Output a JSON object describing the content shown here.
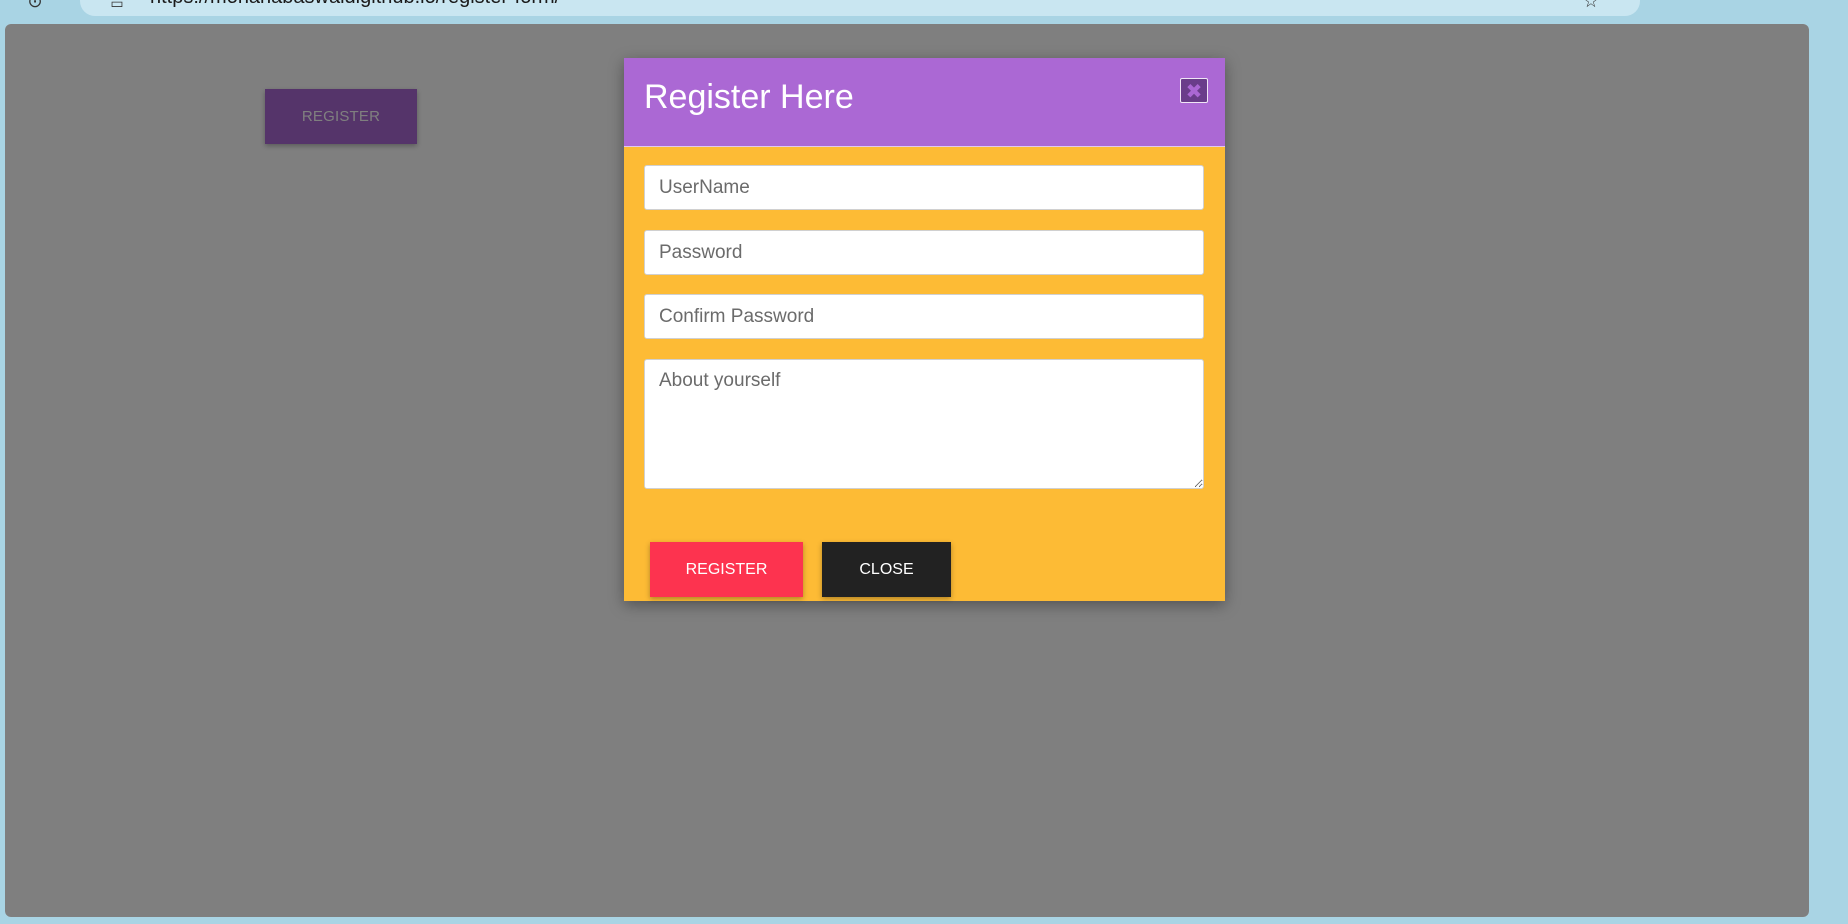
{
  "browser": {
    "url": "https://mohanabaswaldigithub.io/register-form/",
    "back_icon": "back-icon",
    "page_info_icon": "page-info-icon",
    "bookmark_icon": "star-icon"
  },
  "page": {
    "register_button_label": "REGISTER"
  },
  "modal": {
    "title": "Register Here",
    "close_icon_glyph": "✖",
    "fields": {
      "username_placeholder": "UserName",
      "password_placeholder": "Password",
      "confirm_placeholder": "Confirm Password",
      "about_placeholder": "About yourself"
    },
    "register_label": "REGISTER",
    "close_label": "CLOSE"
  },
  "colors": {
    "header": "#ab68d4",
    "body": "#fdbb35",
    "register": "#fd334f",
    "close": "#222222",
    "overlay": "rgba(0,0,0,0.5)"
  }
}
